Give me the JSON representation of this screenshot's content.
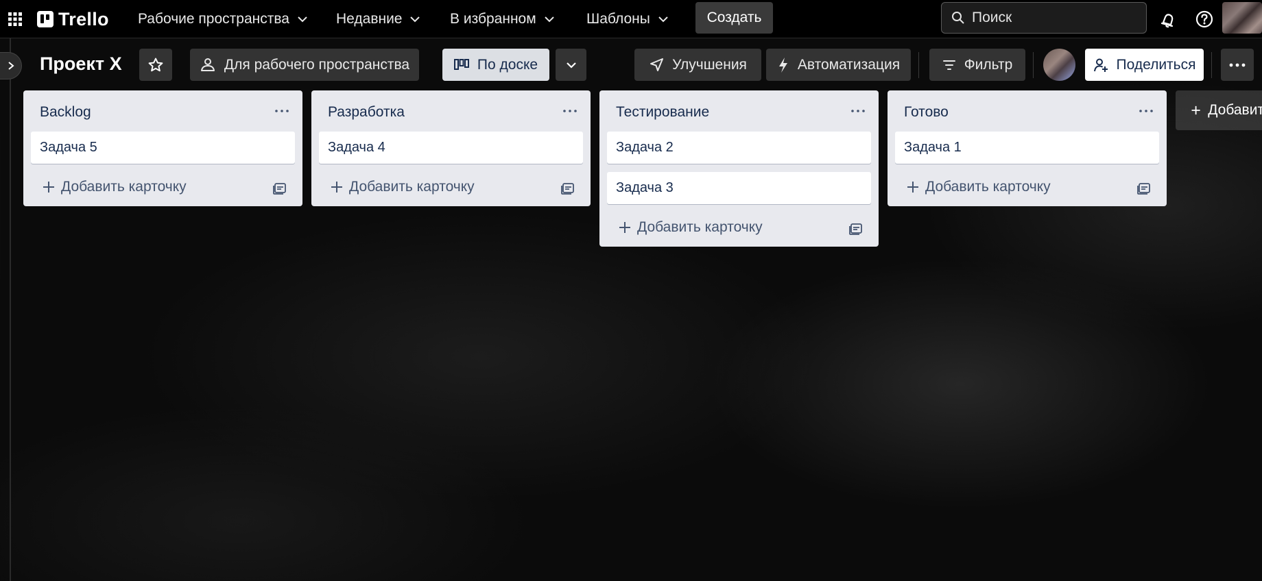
{
  "nav": {
    "logo_text": "Trello",
    "workspaces": "Рабочие пространства",
    "recent": "Недавние",
    "starred": "В избранном",
    "templates": "Шаблоны",
    "create": "Создать",
    "search_placeholder": "Поиск"
  },
  "board": {
    "title": "Проект X",
    "visibility": "Для рабочего пространства",
    "view": "По доске",
    "power_ups": "Улучшения",
    "automation": "Автоматизация",
    "filter": "Фильтр",
    "share": "Поделиться"
  },
  "lists": [
    {
      "title": "Backlog",
      "cards": [
        "Задача 5"
      ],
      "add_card": "Добавить карточку"
    },
    {
      "title": "Разработка",
      "cards": [
        "Задача 4"
      ],
      "add_card": "Добавить карточку"
    },
    {
      "title": "Тестирование",
      "cards": [
        "Задача 2",
        "Задача 3"
      ],
      "add_card": "Добавить карточку"
    },
    {
      "title": "Готово",
      "cards": [
        "Задача 1"
      ],
      "add_card": "Добавить карточку"
    }
  ],
  "add_list": "Добавить",
  "icons": {
    "apps": "grid-icon",
    "notifications": "bell-icon",
    "help": "help-icon",
    "star": "star-icon",
    "visibility": "people-icon",
    "board_view": "board-icon",
    "power_ups": "rocket-icon",
    "automation": "lightning-icon",
    "filter": "filter-icon",
    "share": "add-person-icon",
    "more": "more-icon",
    "template": "template-icon"
  },
  "colors": {
    "nav_bg": "#000000",
    "list_bg": "#e8e9ee",
    "card_bg": "#ffffff",
    "text_dark": "#172b4d",
    "button_dark": "#333333"
  }
}
